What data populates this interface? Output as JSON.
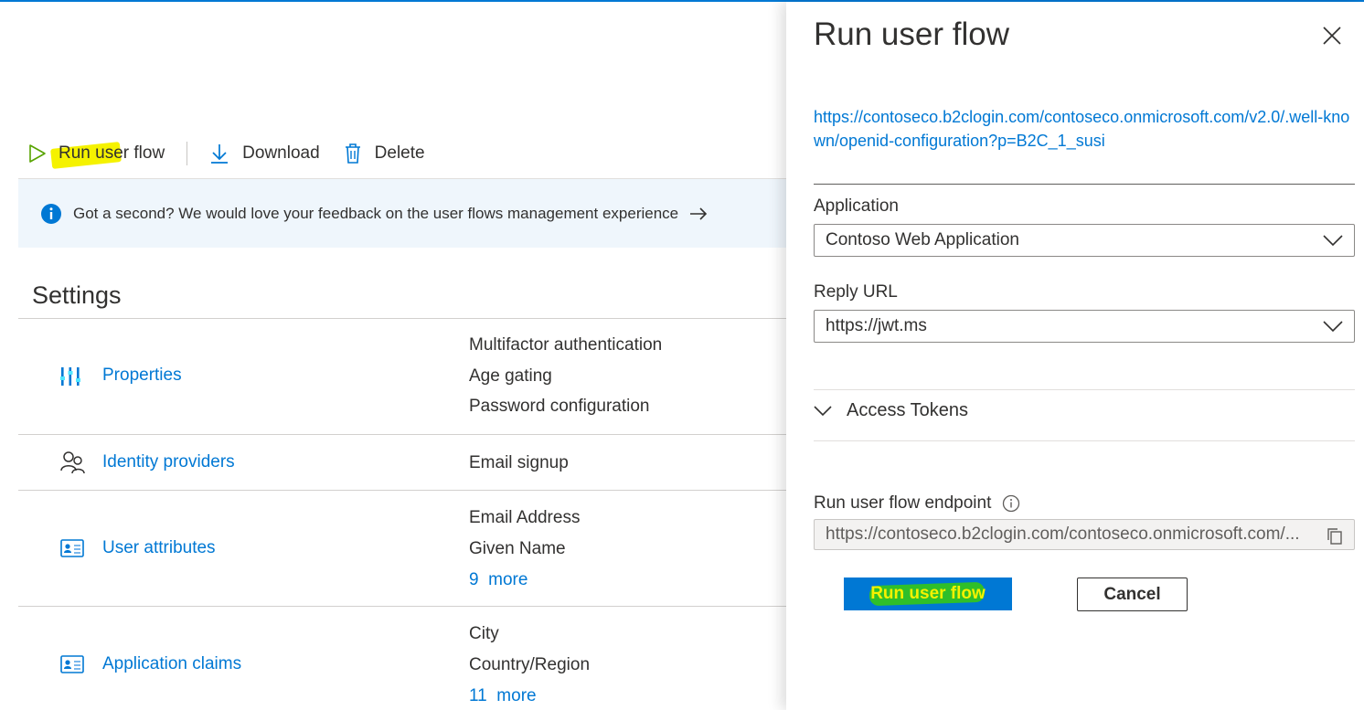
{
  "toolbar": {
    "run_label": "Run user flow",
    "download_label": "Download",
    "delete_label": "Delete"
  },
  "banner": {
    "text": "Got a second? We would love your feedback on the user flows management experience"
  },
  "settings": {
    "title": "Settings",
    "rows": [
      {
        "label": "Properties",
        "values": [
          "Multifactor authentication",
          "Age gating",
          "Password configuration"
        ]
      },
      {
        "label": "Identity providers",
        "values": [
          "Email signup"
        ]
      },
      {
        "label": "User attributes",
        "values": [
          "Email Address",
          "Given Name"
        ],
        "more_count": "9",
        "more_label": "more"
      },
      {
        "label": "Application claims",
        "values": [
          "City",
          "Country/Region"
        ],
        "more_count": "11",
        "more_label": "more"
      }
    ]
  },
  "panel": {
    "title": "Run user flow",
    "metadata_url": "https://contoseco.b2clogin.com/contoseco.onmicrosoft.com/v2.0/.well-known/openid-configuration?p=B2C_1_susi",
    "application_label": "Application",
    "application_value": "Contoso Web Application",
    "reply_url_label": "Reply URL",
    "reply_url_value": "https://jwt.ms",
    "access_tokens_label": "Access Tokens",
    "endpoint_label": "Run user flow endpoint",
    "endpoint_value": "https://contoseco.b2clogin.com/contoseco.onmicrosoft.com/...",
    "run_button": "Run user flow",
    "cancel_button": "Cancel"
  },
  "colors": {
    "accent": "#0078d4",
    "highlight_yellow": "#f5f200",
    "highlight_green": "#2fbf2a",
    "banner_bg": "#eff6fc"
  }
}
